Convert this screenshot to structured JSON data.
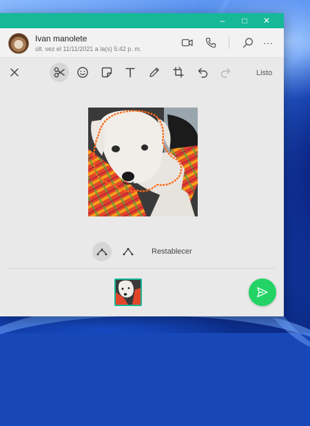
{
  "window": {
    "controls": {
      "minimize": "–",
      "maximize": "□",
      "close": "✕"
    }
  },
  "chat_header": {
    "contact_name": "Ivan manolete",
    "last_seen": "últ. vez el 11/11/2021 a la(s) 5:42 p. m.",
    "icons": [
      "video-call-icon",
      "voice-call-icon",
      "search-icon",
      "more-options-icon"
    ],
    "more_glyph": "···"
  },
  "editor": {
    "toolbar": {
      "icons": [
        "close-icon",
        "scissors-icon",
        "emoji-icon",
        "sticker-icon",
        "text-icon",
        "pencil-icon",
        "crop-rotate-icon",
        "undo-icon",
        "redo-icon"
      ],
      "done_label": "Listo"
    },
    "crop_tools": {
      "icons": [
        "freeform-lasso-icon",
        "polygon-lasso-icon"
      ],
      "reset_label": "Restablecer"
    }
  },
  "colors": {
    "titlebar": "#17b898",
    "send_button": "#23d366",
    "selection_outline": "#ff6a1a"
  }
}
